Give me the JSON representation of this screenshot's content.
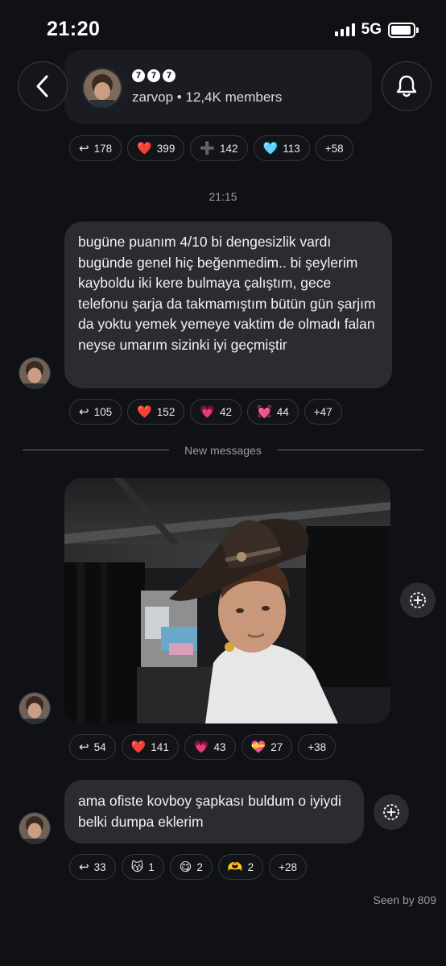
{
  "status": {
    "time": "21:20",
    "network": "5G"
  },
  "header": {
    "badges": [
      "7",
      "7",
      "7"
    ],
    "channel_name": "zarvop",
    "separator": " • ",
    "members": "12,4K members"
  },
  "reactions_top": [
    {
      "emoji": "↩",
      "count": "178",
      "kind": "reply"
    },
    {
      "emoji": "❤️",
      "count": "399"
    },
    {
      "emoji": "➕",
      "count": "142"
    },
    {
      "emoji": "🩵",
      "count": "113"
    },
    {
      "emoji": "",
      "count": "+58"
    }
  ],
  "timestamp": "21:15",
  "message1": {
    "text": "bugüne puanım 4/10 bi dengesizlik vardı bugünde genel hiç beğenmedim.. bi şeylerim kayboldu iki kere bulmaya çalıştım, gece telefonu şarja da takmamıştım bütün gün şarjım da yoktu yemek yemeye vaktim de olmadı falan neyse umarım sizinki iyi geçmiştir"
  },
  "reactions1": [
    {
      "emoji": "↩",
      "count": "105",
      "kind": "reply"
    },
    {
      "emoji": "❤️",
      "count": "152"
    },
    {
      "emoji": "💗",
      "count": "42"
    },
    {
      "emoji": "💓",
      "count": "44"
    },
    {
      "emoji": "",
      "count": "+47"
    }
  ],
  "new_messages_label": "New messages",
  "reactions2": [
    {
      "emoji": "↩",
      "count": "54",
      "kind": "reply"
    },
    {
      "emoji": "❤️",
      "count": "141"
    },
    {
      "emoji": "💗",
      "count": "43"
    },
    {
      "emoji": "💝",
      "count": "27"
    },
    {
      "emoji": "",
      "count": "+38"
    }
  ],
  "message3": {
    "text": "ama ofiste kovboy şapkası buldum o iyiydi belki dumpa eklerim"
  },
  "reactions3": [
    {
      "emoji": "↩",
      "count": "33",
      "kind": "reply"
    },
    {
      "emoji": "😽",
      "count": "1"
    },
    {
      "emoji": "😋",
      "count": "2"
    },
    {
      "emoji": "🫶",
      "count": "2"
    },
    {
      "emoji": "",
      "count": "+28"
    }
  ],
  "seen": "Seen by 809",
  "colors": {
    "background": "#0f1114",
    "bubble": "#2a2c31",
    "chip_border": "#34373e"
  }
}
